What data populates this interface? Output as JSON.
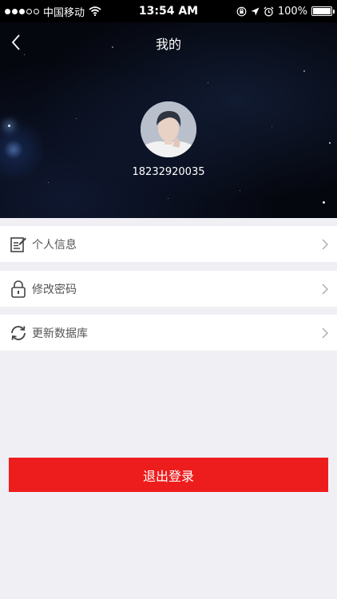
{
  "status_bar": {
    "carrier": "中国移动",
    "time": "13:54 AM",
    "battery": "100%",
    "signal_bars_filled": 3,
    "signal_bars_total": 5
  },
  "header": {
    "title": "我的"
  },
  "profile": {
    "phone": "18232920035"
  },
  "menu": {
    "items": [
      {
        "label": "个人信息",
        "icon": "edit-document-icon"
      },
      {
        "label": "修改密码",
        "icon": "lock-icon"
      },
      {
        "label": "更新数据库",
        "icon": "refresh-icon"
      }
    ]
  },
  "logout": {
    "label": "退出登录"
  },
  "colors": {
    "accent_red": "#ee1d1d",
    "background": "#efeff4",
    "header_bg": "#05070f"
  }
}
